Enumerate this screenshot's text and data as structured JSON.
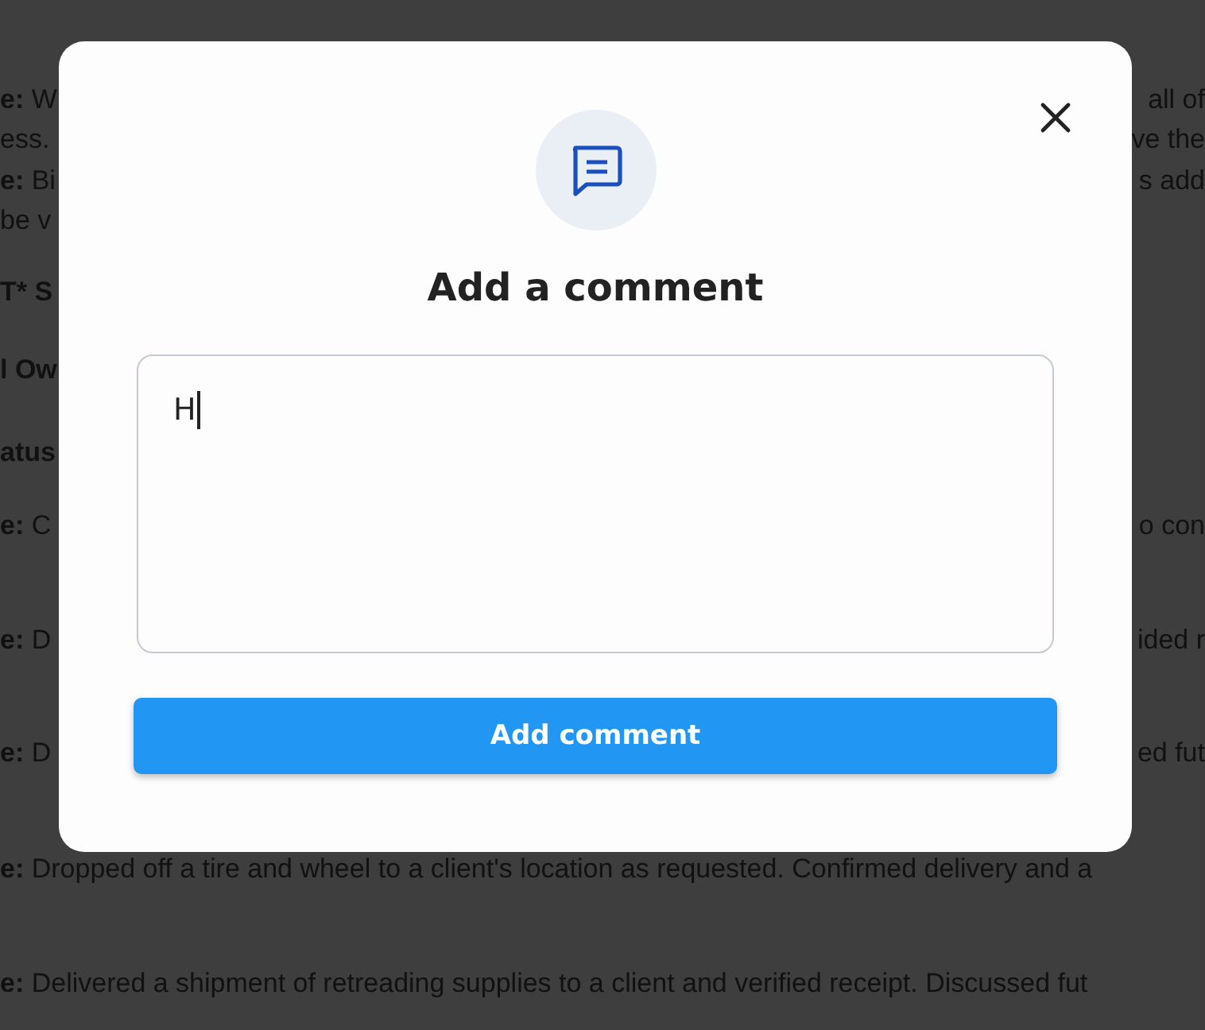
{
  "background_lines": [
    {
      "left": "**e:** W",
      "right": "all of"
    },
    {
      "left": "ess.",
      "right": "ve the"
    },
    {
      "left": "**e:** Bi",
      "right": "s add"
    },
    {
      "left": "be v"
    },
    {
      "left": "**T* S**"
    },
    {
      "left": "**l Ow**"
    },
    {
      "left": "**atus**"
    },
    {
      "left": "**e:** C",
      "right": "o con"
    },
    {
      "left": "**e:** D",
      "right": "ided r"
    },
    {
      "left": "**e:** D",
      "right": "ed fut"
    },
    {
      "left": "**e:** Dropped off a tire and wheel to a client's location as requested. Confirmed delivery and a"
    },
    {
      "left": "**e:** Delivered a shipment of retreading supplies to a client and verified receipt. Discussed fut"
    }
  ],
  "dialog": {
    "title": "Add a comment",
    "comment_field": {
      "value": "H",
      "focused": true
    },
    "submit_button": "Add comment"
  }
}
